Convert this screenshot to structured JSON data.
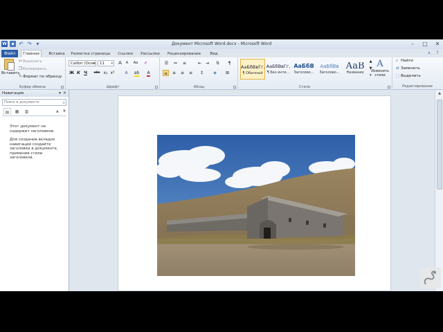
{
  "window": {
    "title": "Документ Microsoft Word.docx - Microsoft Word",
    "app_icon": "W",
    "controls": [
      "–",
      "□",
      "✕"
    ]
  },
  "tabs": {
    "file": "Файл",
    "items": [
      "Главная",
      "Вставка",
      "Разметка страницы",
      "Ссылки",
      "Рассылки",
      "Рецензирование",
      "Вид"
    ],
    "active": "Главная"
  },
  "clipboard": {
    "paste": "Вставить",
    "cut": "Вырезать",
    "copy": "Копировать",
    "format_painter": "Формат по образцу",
    "label": "Буфер обмена"
  },
  "font": {
    "name": "Calibri (Осно",
    "size": "11",
    "label": "Шрифт",
    "bold": "Ж",
    "italic": "К",
    "underline": "Ч",
    "strike": "abc",
    "subscript": "x₂",
    "superscript": "x²",
    "grow": "A",
    "shrink": "A",
    "clear": "Aa",
    "color_letter": "A",
    "color": "#d12b2b",
    "highlight": "#f5e000"
  },
  "paragraph": {
    "label": "Абзац",
    "pilcrow": "¶"
  },
  "styles": {
    "label": "Стили",
    "items": [
      {
        "sample": "АаБбВвГг,",
        "name": "¶ Обычный"
      },
      {
        "sample": "АаБбВвГг,",
        "name": "¶ Без инте..."
      },
      {
        "sample": "АаБбВ",
        "name": "Заголово..."
      },
      {
        "sample": "АаБбВв",
        "name": "Заголово..."
      },
      {
        "sample": "АаВ",
        "name": "Название"
      }
    ],
    "change": "Изменить стили"
  },
  "editing": {
    "label": "Редактирование",
    "find": "Найти",
    "replace": "Заменить",
    "select": "Выделить"
  },
  "nav": {
    "title": "Навигация",
    "search_placeholder": "Поиск в документе",
    "message1": "Этот документ не содержит заголовков.",
    "message2": "Для создания вкладок навигации создайте заголовки в документе, применив стили заголовков."
  }
}
